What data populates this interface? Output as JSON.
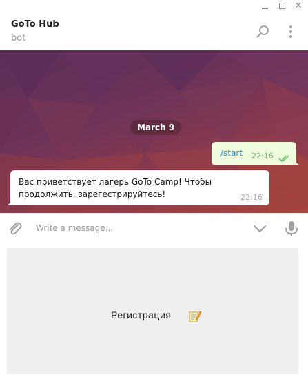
{
  "window": {
    "controls": [
      "minimize-icon",
      "maximize-icon",
      "close-icon"
    ]
  },
  "header": {
    "title": "GoTo Hub",
    "subtitle": "bot",
    "icons": [
      "search-icon",
      "more-vertical-icon"
    ]
  },
  "chat": {
    "date_separator": "March 9",
    "messages": [
      {
        "direction": "outgoing",
        "text": "/start",
        "time": "22:16",
        "status": "read"
      },
      {
        "direction": "incoming",
        "text": "Вас приветствует лагерь GoTo Camp! Чтобы продолжить, зарегестрируйтесь!",
        "time": "22:16"
      }
    ]
  },
  "composer": {
    "placeholder": "Write a message...",
    "icons": [
      "paperclip-icon",
      "chevron-down-icon",
      "microphone-icon"
    ]
  },
  "keyboard": {
    "buttons": [
      {
        "label": "Регистрация",
        "emoji_icon": "memo-icon"
      }
    ]
  },
  "colors": {
    "outgoing_bubble": "#effdde",
    "incoming_bubble": "#ffffff",
    "read_check": "#5fbf5f",
    "keyboard_button": "#efefef"
  }
}
